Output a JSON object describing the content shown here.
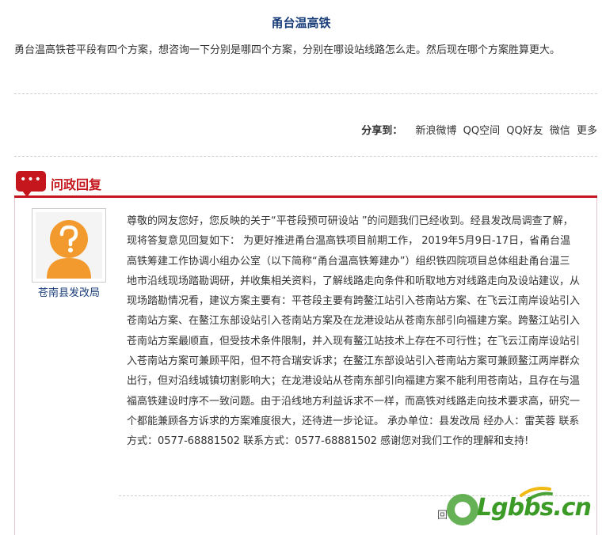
{
  "page": {
    "title": "甬台温高铁",
    "question": "勇台温高铁苍平段有四个方案，想咨询一下分别是哪四个方案，分别在哪设站线路怎么走。然后现在哪个方案胜算更大。"
  },
  "share": {
    "label": "分享到：",
    "links": [
      "新浪微博",
      "QQ空间",
      "QQ好友",
      "微信",
      "更多"
    ]
  },
  "reply": {
    "header": "问政回复",
    "icon_dots": "•••",
    "department": "苍南县发改局",
    "body": "尊敬的网友您好，您反映的关于“平苍段预可研设站 ”的问题我们已经收到。经县发改局调查了解，现将答复意见回复如下： 为更好推进甬台温高铁项目前期工作， 2019年5月9日-17日，省甬台温高铁筹建工作协调小组办公室（以下简称“甬台温高铁筹建办”）组织铁四院项目总体组赴甬台温三地市沿线现场踏勘调研，并收集相关资料，了解线路走向条件和听取地方对线路走向及设站建议，从现场踏勘情况看，建议方案主要有：平苍段主要有跨鳌江站引入苍南站方案、在飞云江南岸设站引入苍南站方案、在鳌江东部设站引入苍南站方案及在龙港设站从苍南东部引向福建方案。跨鳌江站引入苍南站方案最顺直，但受技术条件限制，并入现有鳌江站技术上存在不可行性；在飞云江南岸设站引入苍南站方案可兼顾平阳，但不符合瑞安诉求；在鳌江东部设站引入苍南站方案可兼顾鳌江两岸群众出行，但对沿线城镇切割影响大；在龙港设站从苍南东部引向福建方案不能利用苍南站，且存在与温福高铁建设时序不一致问题。由于沿线地方利益诉求不一样，而高铁对线路走向技术要求高，研究一个都能兼顾各方诉求的方案难度很大，还待进一步论证。 承办单位：县发改局 经办人：雷芙蓉 联系方式：0577-68881502 联系方式：0577-68881502 感谢您对我们工作的理解和支持!",
    "footer_partial": "回"
  },
  "watermark": {
    "text": "Lgbbs.cn"
  },
  "colors": {
    "title_blue": "#1a3e7a",
    "accent_red": "#c4161c",
    "avatar_orange": "#f29a2e",
    "watermark_green": "#3c9b27"
  }
}
